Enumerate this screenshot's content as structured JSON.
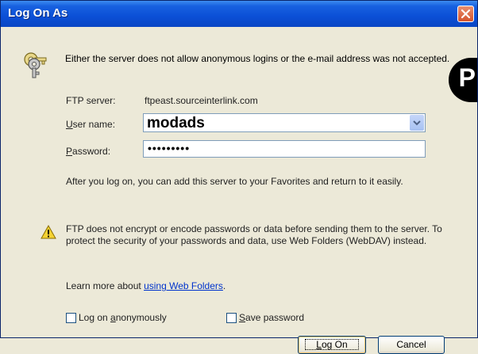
{
  "window": {
    "title": "Log On As"
  },
  "dialog": {
    "notice": "Either the server does not allow anonymous logins or the e-mail address was not accepted.",
    "ftp_server_label": "FTP server:",
    "ftp_server_value": "ftpeast.sourceinterlink.com",
    "username_label_pre": "",
    "username_label_accel": "U",
    "username_label_post": "ser name:",
    "username_value": "modads",
    "password_label_accel": "P",
    "password_label_post": "assword:",
    "password_value": "•••••••••",
    "after_logon_text": "After you log on, you can add this server to your Favorites and return to it easily.",
    "warning_text": "FTP does not encrypt or encode passwords or data before sending them to the server.  To protect the security of your passwords and data, use Web Folders (WebDAV) instead.",
    "learn_more_prefix": "Learn more about ",
    "learn_more_link": "using Web Folders",
    "learn_more_suffix": ".",
    "anon_label_pre": "Log on ",
    "anon_label_accel": "a",
    "anon_label_post": "nonymously",
    "save_label_accel": "S",
    "save_label_post": "ave password",
    "logon_accel": "L",
    "logon_post": "og On",
    "cancel_label": "Cancel"
  },
  "overlay": {
    "corner_letter": "P"
  },
  "icons": [
    "keys-icon",
    "warning-icon",
    "close-icon",
    "chevron-down-icon"
  ]
}
